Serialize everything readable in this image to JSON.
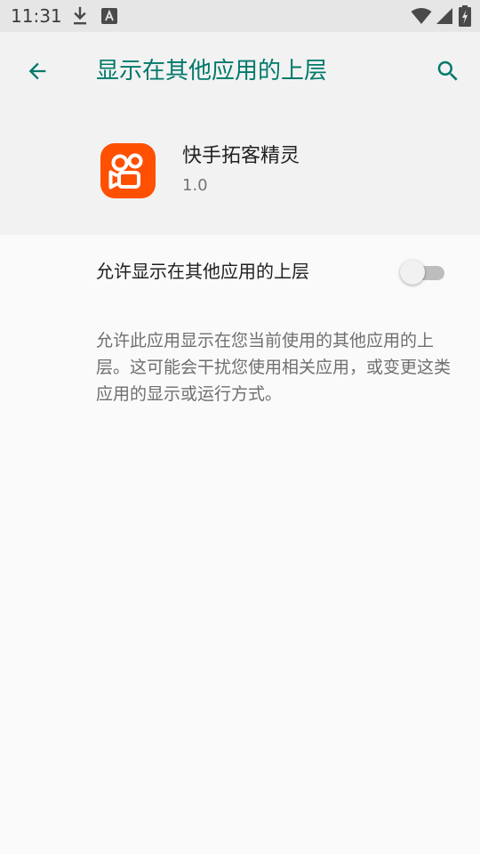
{
  "status_bar": {
    "time": "11:31",
    "icons": [
      "download-icon",
      "text-a-icon",
      "wifi-icon",
      "signal-icon",
      "battery-icon"
    ]
  },
  "header": {
    "title": "显示在其他应用的上层",
    "back_icon": "arrow-back-icon",
    "search_icon": "search-icon"
  },
  "app": {
    "name": "快手拓客精灵",
    "version": "1.0",
    "icon": "kuaishou-camera-icon"
  },
  "setting": {
    "label": "允许显示在其他应用的上层",
    "enabled": false
  },
  "description": "允许此应用显示在您当前使用的其他应用的上层。这可能会干扰您使用相关应用，或变更这类应用的显示或运行方式。",
  "colors": {
    "accent": "#00796b",
    "app_icon_bg": "#ff5000",
    "header_bg": "#f2f2f2",
    "page_bg": "#fafafa",
    "status_bar_bg": "#e6e6e6"
  }
}
